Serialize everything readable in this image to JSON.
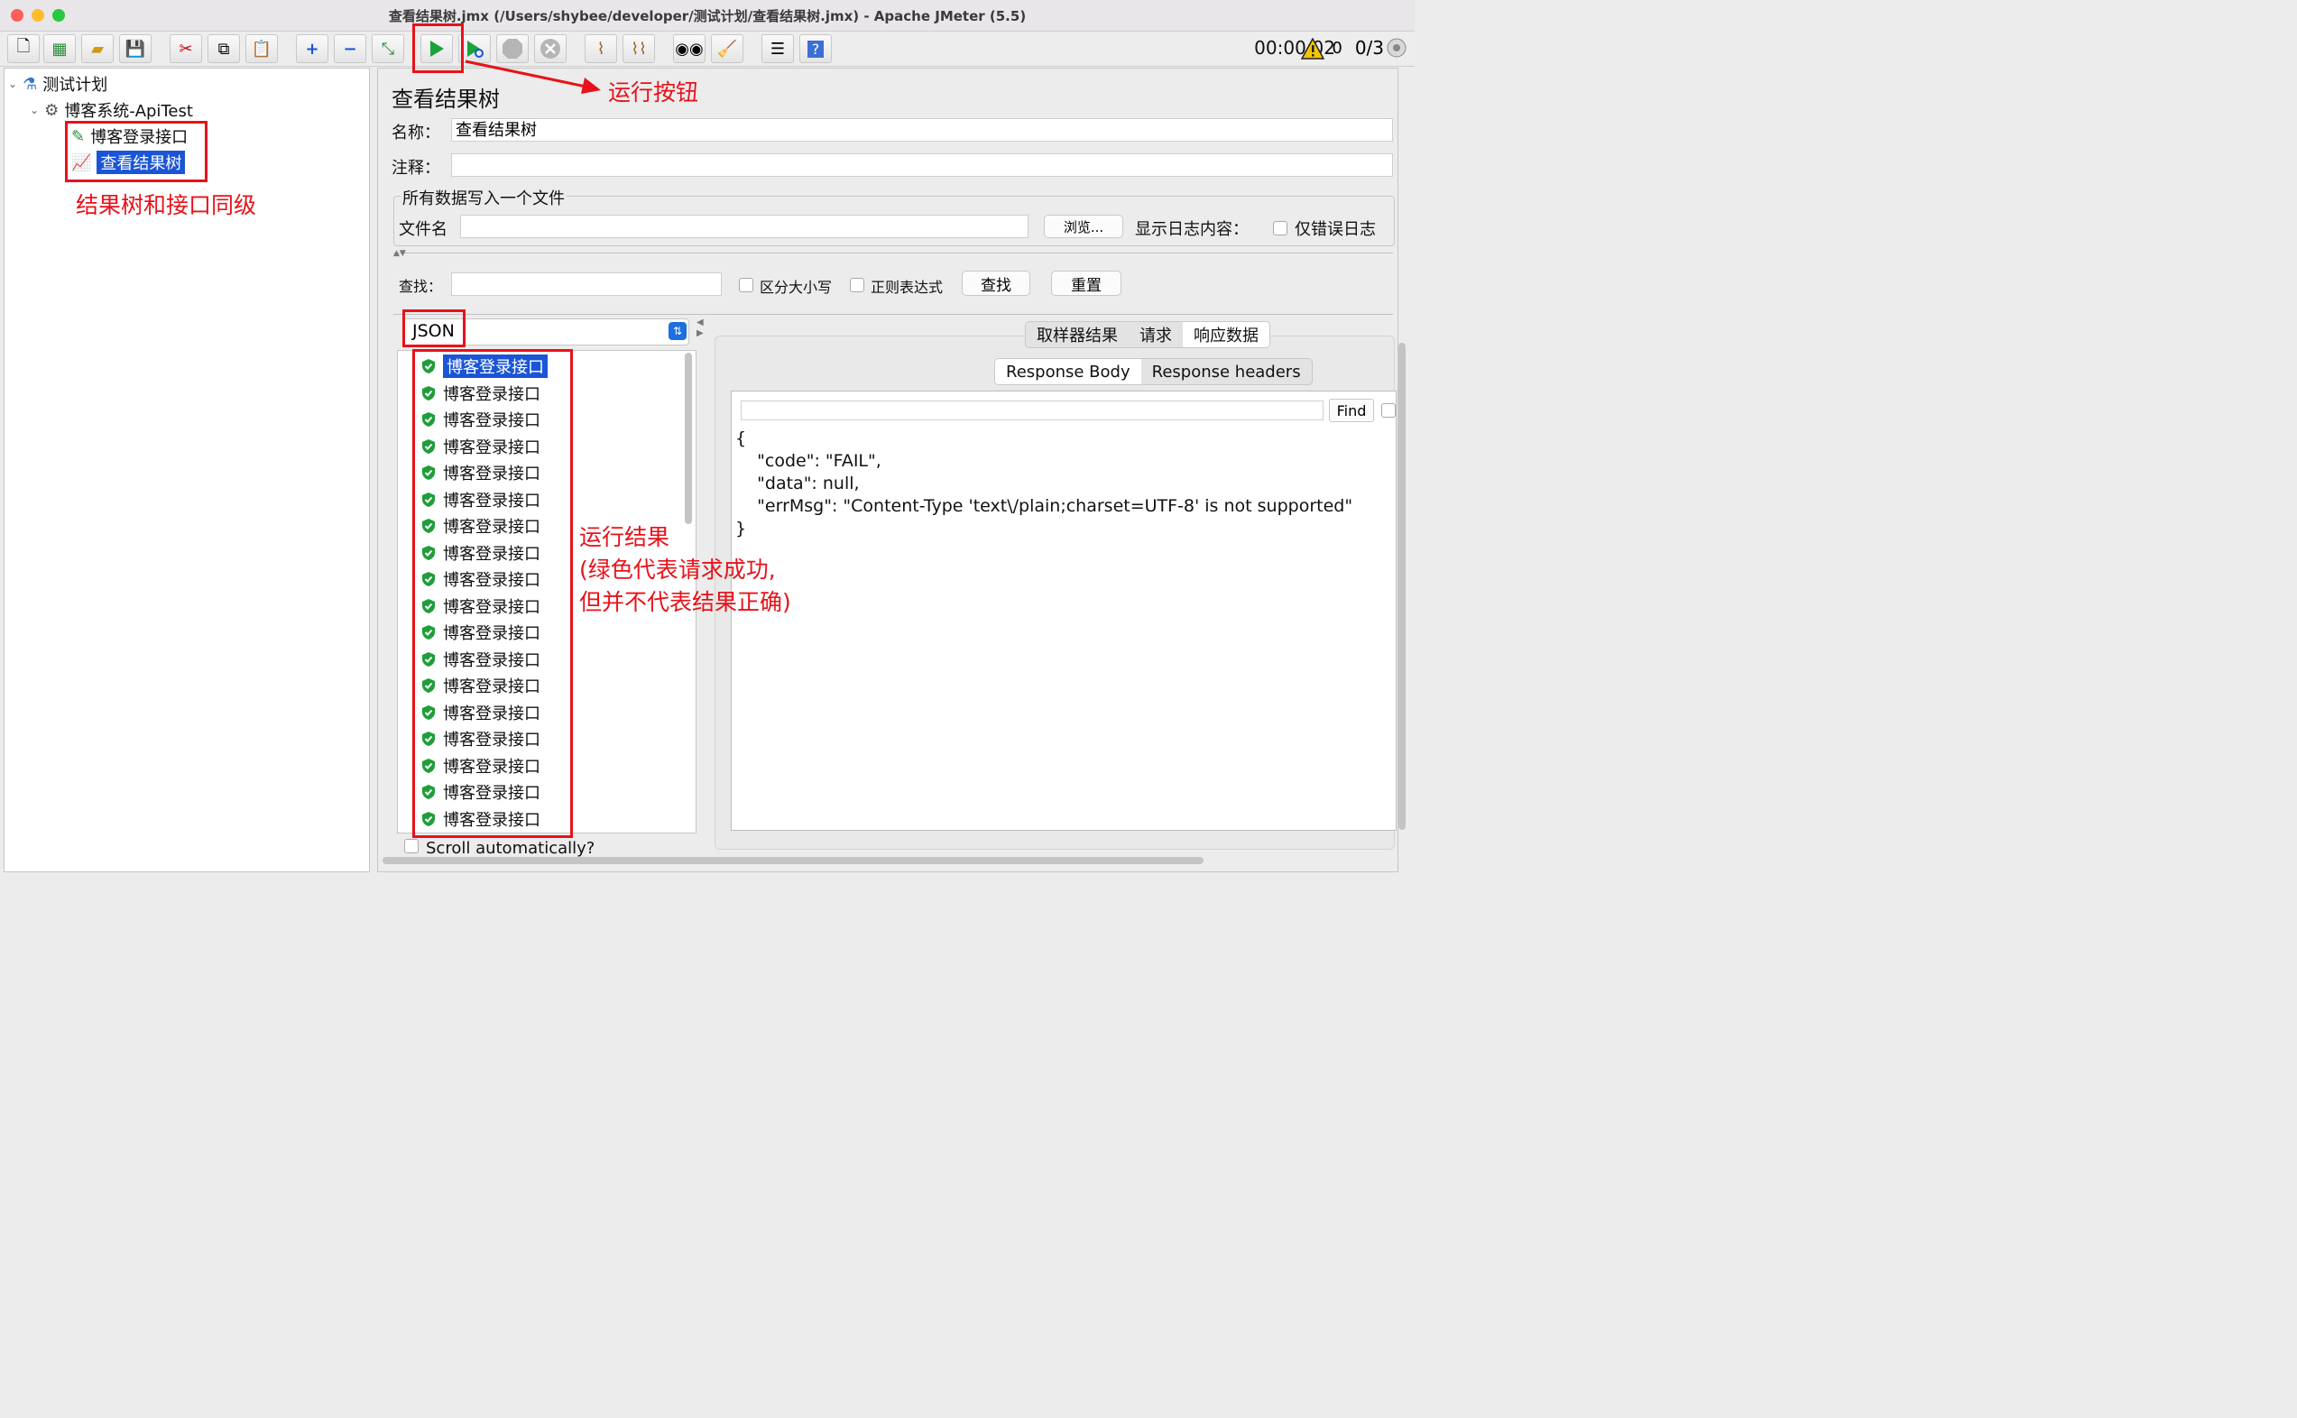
{
  "window": {
    "title": "查看结果树.jmx (/Users/shybee/developer/测试计划/查看结果树.jmx) - Apache JMeter (5.5)"
  },
  "toolbar": {
    "timer": "00:00:02",
    "warnings": "0",
    "threads": "0/3"
  },
  "tree": {
    "plan": "测试计划",
    "thread_group": "博客系统-ApiTest",
    "sampler": "博客登录接口",
    "listener": "查看结果树"
  },
  "panel": {
    "heading": "查看结果树",
    "name_label": "名称：",
    "name_value": "查看结果树",
    "comment_label": "注释：",
    "comment_value": "",
    "file_section": "所有数据写入一个文件",
    "filename_label": "文件名",
    "filename_value": "",
    "browse": "浏览...",
    "log_label": "显示日志内容：",
    "errors_only": "仅错误日志",
    "search_label": "查找：",
    "search_value": "",
    "case_sensitive": "区分大小写",
    "regex": "正则表达式",
    "find_btn": "查找",
    "reset_btn": "重置",
    "renderer": "JSON",
    "scroll_auto": "Scroll automatically?",
    "tab_sampler": "取样器结果",
    "tab_request": "请求",
    "tab_response": "响应数据",
    "sub_body": "Response Body",
    "sub_headers": "Response headers",
    "find_small": "Find",
    "response_text": "{\n    \"code\": \"FAIL\",\n    \"data\": null,\n    \"errMsg\": \"Content-Type 'text\\/plain;charset=UTF-8' is not supported\"\n}"
  },
  "results": [
    "博客登录接口",
    "博客登录接口",
    "博客登录接口",
    "博客登录接口",
    "博客登录接口",
    "博客登录接口",
    "博客登录接口",
    "博客登录接口",
    "博客登录接口",
    "博客登录接口",
    "博客登录接口",
    "博客登录接口",
    "博客登录接口",
    "博客登录接口",
    "博客登录接口",
    "博客登录接口",
    "博客登录接口",
    "博客登录接口"
  ],
  "annotations": {
    "run_button": "运行按钮",
    "same_level": "结果树和接口同级",
    "run_result_1": "运行结果",
    "run_result_2": "(绿色代表请求成功,",
    "run_result_3": "但并不代表结果正确)"
  },
  "colors": {
    "accent": "#1b55d6",
    "annotation": "#e8121a",
    "success": "#1f9e3a"
  }
}
